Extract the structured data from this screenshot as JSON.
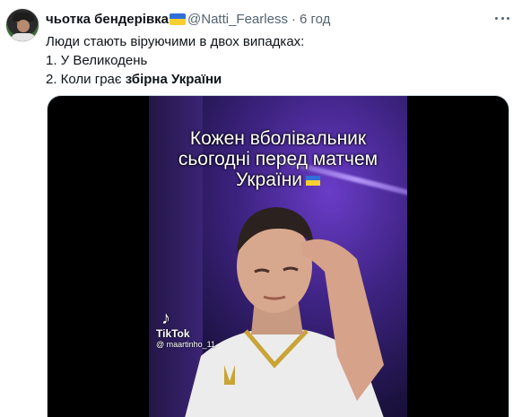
{
  "tweet": {
    "author_name": "чьотка бендерівка",
    "author_handle": "@Natti_Fearless",
    "separator": "·",
    "time": "6 год",
    "text_line1": "Люди стають віруючими в двох випадках:",
    "text_line2": "1. У Великодень",
    "text_line3_prefix": "2. Коли грає ",
    "text_line3_bold": "збірна України"
  },
  "video": {
    "caption_line1": "Кожен вболівальник",
    "caption_line2": "сьогодні перед матчем",
    "caption_line3": "України",
    "watermark_app": "TikTok",
    "watermark_user": "@ maartinho_11"
  },
  "icons": {
    "more": "more-horizontal-icon",
    "flag": "ukraine-flag-icon",
    "tiktok": "tiktok-logo-icon"
  },
  "colors": {
    "text_primary": "#0f1419",
    "text_secondary": "#536471",
    "flag_blue": "#2f6fd6",
    "flag_yellow": "#f8cf2f",
    "video_bg": "#000000"
  }
}
